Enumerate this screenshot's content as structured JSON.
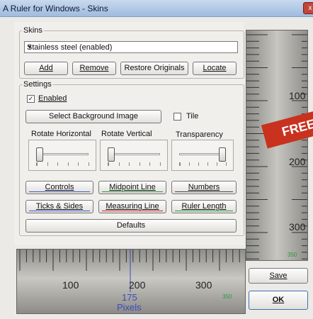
{
  "window": {
    "title": "A Ruler for Windows - Skins",
    "close_label": "x"
  },
  "skins": {
    "group_label": "Skins",
    "selected": "Stainless steel (enabled)",
    "buttons": {
      "add": "Add",
      "remove": "Remove",
      "restore": "Restore Originals",
      "locate": "Locate"
    }
  },
  "settings": {
    "group_label": "Settings",
    "enabled_label": "Enabled",
    "enabled_checked": true,
    "select_bg": "Select Background Image",
    "tile_label": "Tile",
    "tile_checked": false,
    "rotate_h_label": "Rotate Horizontal",
    "rotate_v_label": "Rotate Vertical",
    "transparency_label": "Transparency",
    "rotate_h_value": 0.0,
    "rotate_v_value": 0.0,
    "transparency_value": 1.0,
    "color_buttons": [
      {
        "key": "controls",
        "label": "Controls",
        "line": "#3b5bd0"
      },
      {
        "key": "midpoint",
        "label": "Midpoint Line",
        "line": "#2a9a3a"
      },
      {
        "key": "numbers",
        "label": "Numbers",
        "line": "#4a4a4a"
      },
      {
        "key": "ticks",
        "label": "Ticks & Sides",
        "line": "#3b5bd0"
      },
      {
        "key": "measuring",
        "label": "Measuring Line",
        "line": "#d02a2a"
      },
      {
        "key": "ruler_length",
        "label": "Ruler Length",
        "line": "#2a9a3a"
      }
    ],
    "defaults": "Defaults"
  },
  "vruler": {
    "numbers": [
      "100",
      "200",
      "300"
    ],
    "length": "350"
  },
  "hruler": {
    "numbers": [
      "100",
      "200",
      "300"
    ],
    "measure_value": "175",
    "measure_unit": "Pixels",
    "length": "350"
  },
  "badge": "FREE",
  "actions": {
    "save": "Save",
    "ok": "OK"
  }
}
